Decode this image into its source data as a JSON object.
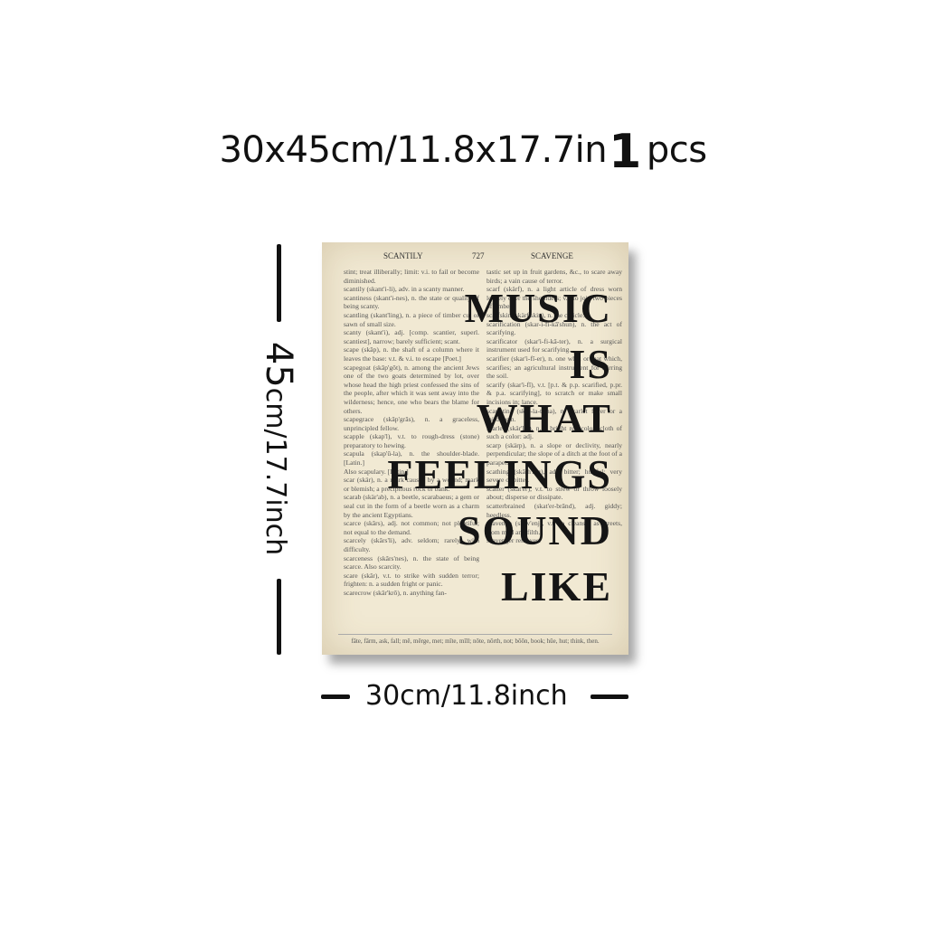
{
  "size_label": {
    "dims": "30x45cm/11.8x17.7in",
    "qty": "1",
    "unit": "pcs"
  },
  "height_label": {
    "big": "45",
    "small": "cm/17.7inch"
  },
  "width_label": "30cm/11.8inch",
  "poster": {
    "header": {
      "left": "SCANTILY",
      "page": "727",
      "right": "SCAVENGE"
    },
    "quote": [
      "MUSIC",
      "IS",
      "WHAT",
      "FEELINGS",
      "SOUND",
      "LIKE"
    ],
    "left_column": [
      "stint; treat illiberally; limit: v.i. to fail or become diminished.",
      "scantily (skant'i-li), adv. in a scanty manner.",
      "scantiness (skant'i-nes), n. the state or quality of being scanty.",
      "scantling (skant'ling), n. a piece of timber cut or sawn of small size.",
      "scanty (skant'i), adj. [comp. scantier, superl. scantiest], narrow; barely sufficient; scant.",
      "scape (skāp), n. the shaft of a column where it leaves the base: v.t. & v.i. to escape [Poet.]",
      "scapegoat (skāp'gōt), n. among the ancient Jews one of the two goats determined by lot, over whose head the high priest confessed the sins of the people, after which it was sent away into the wilderness; hence, one who bears the blame for others.",
      "scapegrace (skāp'grās), n. a graceless, unprincipled fellow.",
      "scapple (skap'l), v.t. to rough-dress (stone) preparatory to hewing.",
      "scapula (skap'ū-la), n. the shoulder-blade. [Latin.]",
      "Also scapulary. [Latin.]",
      "scar (skär), n. a mark caused by a wound; mark or blemish; a precipitous rock or bank.",
      "scarab (skär'ab), n. a beetle, scarabaeus; a gem or seal cut in the form of a beetle worn as a charm by the ancient Egyptians.",
      "scarce (skârs), adj. not common; not plentiful; not equal to the demand.",
      "scarcely (skârs'li), adv. seldom; rarely; with difficulty.",
      "scarceness (skârs'nes), n. the state of being scarce. Also scarcity.",
      "scare (skâr), v.t. to strike with sudden terror; frighten: n. a sudden fright or panic.",
      "scarecrow (skâr'krō), n. anything fan-"
    ],
    "right_column": [
      "tastic set up in fruit gardens, &c., to scare away birds; a vain cause of terror.",
      "scarf (skärf), n. a light article of dress worn loosely over the shoulders; v.t. to join two pieces of timber.",
      "scarfskin (skärf'skin), n. the cuticle.",
      "scarification (skar-i-fi-kā'shun), n. the act of scarifying.",
      "scarificator (skar'i-fi-kā-ter), n. a surgical instrument used for scarifying.",
      "scarifier (skar'i-fī-er), n. one who, or that which, scarifies; an agricultural instrument for stirring the soil.",
      "scarify (skar'i-fī), v.t. [p.t. & p.p. scarified, p.pr. & p.a. scarifying], to scratch or make small incisions in; lance.",
      "scarlatina (skär-la-tē'na), n. scarlet fever or a mild form.",
      "scarlet (skär'let), n. a bright red color; cloth of such a color: adj.",
      "scarp (skärp), n. a slope or declivity, nearly perpendicular; the slope of a ditch at the foot of a parapet.",
      "scathing (skāth'ing), adj. bitter; hurtful; very severe or bitter.",
      "scatter (skat'er), v.t. to strew or throw loosely about; disperse or dissipate.",
      "scatterbrained (skat'er-brānd), adj. giddy; heedless.",
      "scavenge (skav'enj), v.t. to cleanse, as streets, from mud and filth.",
      "scavenger removes."
    ],
    "footer": "fāte, fārm, ask, fall; mē, mērge, met; mīte, mĭll; nōte, nōrth, not; bōōn, book; hūe, hut; think, then."
  }
}
